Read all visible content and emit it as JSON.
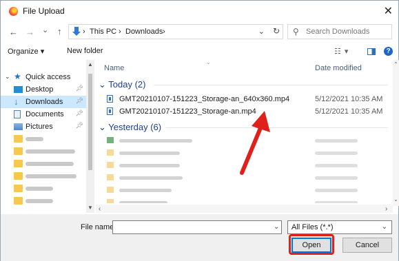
{
  "window": {
    "title": "File Upload",
    "close_glyph": "✕",
    "app_icon": "firefox-icon"
  },
  "nav": {
    "back": "←",
    "forward": "→",
    "recent": "⌄",
    "up": "↑",
    "path": [
      "This PC",
      "Downloads"
    ],
    "sep": "›",
    "refresh": "↻",
    "search_placeholder": "Search Downloads"
  },
  "toolbar": {
    "organize": "Organize ▾",
    "new_folder": "New folder",
    "view_glyph": "☷ ▾",
    "help": "?"
  },
  "sidebar": {
    "quick_access": "Quick access",
    "items": [
      {
        "label": "Desktop",
        "icon": "desktop-icon",
        "pinned": true
      },
      {
        "label": "Downloads",
        "icon": "downloads-icon",
        "pinned": true,
        "selected": true
      },
      {
        "label": "Documents",
        "icon": "documents-icon",
        "pinned": true
      },
      {
        "label": "Pictures",
        "icon": "pictures-icon",
        "pinned": true
      }
    ]
  },
  "columns": {
    "name": "Name",
    "date": "Date modified"
  },
  "groups": {
    "today": {
      "label": "Today (2)",
      "files": [
        {
          "name": "GMT20210107-151223_Storage-an_640x360.mp4",
          "date": "5/12/2021 10:35 AM"
        },
        {
          "name": "GMT20210107-151223_Storage-an.mp4",
          "date": "5/12/2021 10:35 AM"
        }
      ]
    },
    "yesterday": {
      "label": "Yesterday (6)"
    }
  },
  "footer": {
    "file_name_label": "File name:",
    "file_name_value": "",
    "filter": "All Files (*.*)",
    "open": "Open",
    "cancel": "Cancel"
  },
  "colors": {
    "accent": "#0078d7",
    "selection": "#cce8ff",
    "annotation": "#e0201a",
    "group_text": "#1c3f8e"
  }
}
